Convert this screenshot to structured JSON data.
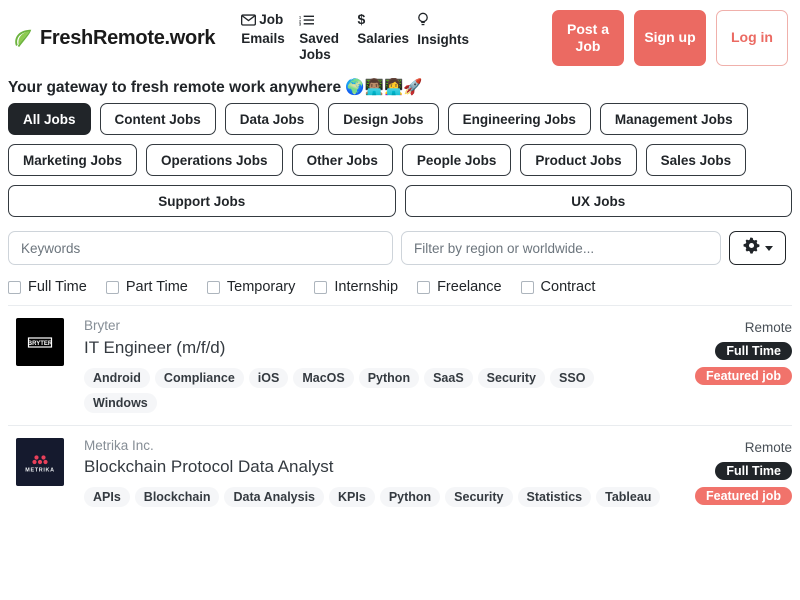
{
  "header": {
    "brand_name": "FreshRemote.work",
    "leaf_icon": "leaf-icon",
    "nav": [
      {
        "label": "Job Emails",
        "icon": "envelope-icon",
        "name": "nav-job-emails"
      },
      {
        "label": "Saved Jobs",
        "icon": "list-ol-icon",
        "name": "nav-saved-jobs"
      },
      {
        "label": "Salaries",
        "icon": "dollar-icon",
        "name": "nav-salaries"
      },
      {
        "label": "Insights",
        "icon": "lightbulb-icon",
        "name": "nav-insights"
      }
    ],
    "post_job_label": "Post a Job",
    "sign_up_label": "Sign up",
    "log_in_label": "Log in",
    "accent_color": "#eb6a62"
  },
  "tagline": {
    "text": "Your gateway to fresh remote work anywhere",
    "emojis": "🌍👨🏽‍💻👩‍💻🚀"
  },
  "categories": {
    "row1": [
      {
        "label": "All Jobs",
        "active": true
      },
      {
        "label": "Content Jobs",
        "active": false
      },
      {
        "label": "Data Jobs",
        "active": false
      },
      {
        "label": "Design Jobs",
        "active": false
      },
      {
        "label": "Engineering Jobs",
        "active": false
      },
      {
        "label": "Management Jobs",
        "active": false
      }
    ],
    "row2": [
      {
        "label": "Marketing Jobs",
        "active": false
      },
      {
        "label": "Operations Jobs",
        "active": false
      },
      {
        "label": "Other Jobs",
        "active": false
      },
      {
        "label": "People Jobs",
        "active": false
      },
      {
        "label": "Product Jobs",
        "active": false
      },
      {
        "label": "Sales Jobs",
        "active": false
      }
    ],
    "row3": [
      {
        "label": "Support Jobs",
        "active": false
      },
      {
        "label": "UX Jobs",
        "active": false
      }
    ]
  },
  "search": {
    "keywords_value": "",
    "keywords_placeholder": "Keywords",
    "region_value": "",
    "region_placeholder": "Filter by region or worldwide...",
    "settings_icon": "gear-icon"
  },
  "job_type_filters": [
    {
      "label": "Full Time",
      "checked": false
    },
    {
      "label": "Part Time",
      "checked": false
    },
    {
      "label": "Temporary",
      "checked": false
    },
    {
      "label": "Internship",
      "checked": false
    },
    {
      "label": "Freelance",
      "checked": false
    },
    {
      "label": "Contract",
      "checked": false
    }
  ],
  "jobs": [
    {
      "company": "Bryter",
      "title": "IT Engineer (m/f/d)",
      "logo_text": "BRYTER",
      "logo_bg": "#000000",
      "location": "Remote",
      "type_badge": "Full Time",
      "featured_badge": "Featured job",
      "tags": [
        "Android",
        "Compliance",
        "iOS",
        "MacOS",
        "Python",
        "SaaS",
        "Security",
        "SSO",
        "Windows"
      ]
    },
    {
      "company": "Metrika Inc.",
      "title": "Blockchain Protocol Data Analyst",
      "logo_text": "METRIKA",
      "logo_bg": "#151a2e",
      "location": "Remote",
      "type_badge": "Full Time",
      "featured_badge": "Featured job",
      "tags": [
        "APIs",
        "Blockchain",
        "Data Analysis",
        "KPIs",
        "Python",
        "Security",
        "Statistics",
        "Tableau"
      ]
    }
  ]
}
